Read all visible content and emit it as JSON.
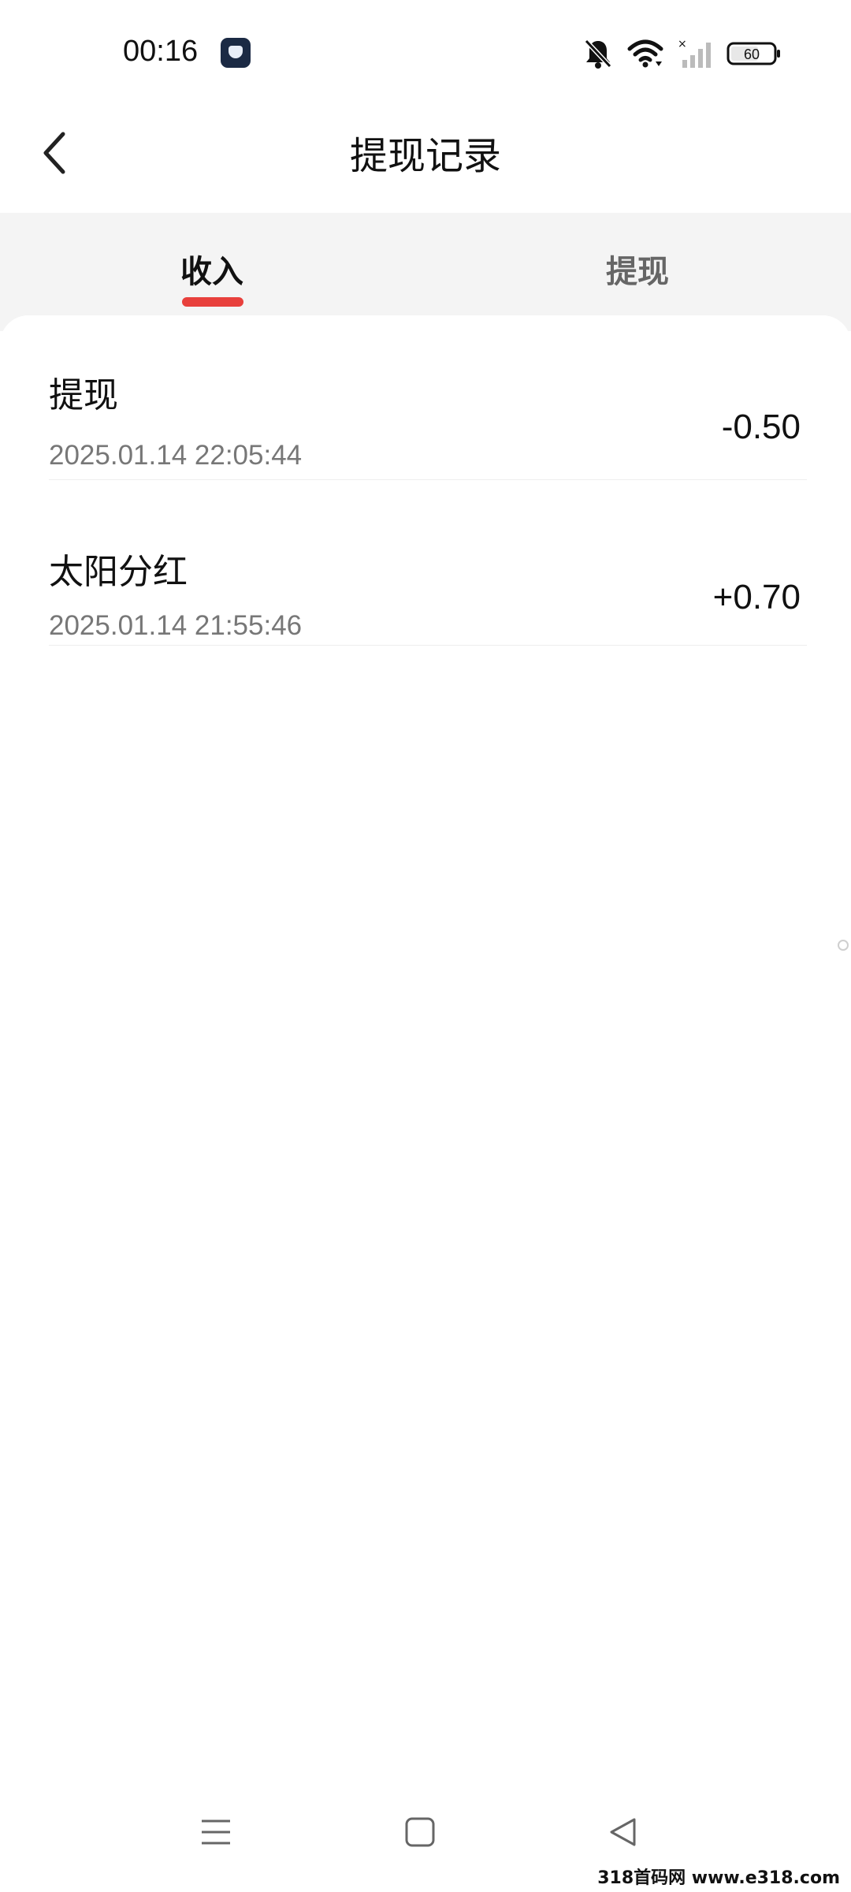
{
  "status_bar": {
    "time": "00:16",
    "battery": "60",
    "icons": [
      "app-badge-icon",
      "bell-off-icon",
      "wifi-icon",
      "signal-icon",
      "battery-icon"
    ]
  },
  "header": {
    "title": "提现记录",
    "back_icon": "chevron-left-icon"
  },
  "tabs": [
    {
      "label": "收入",
      "active": true
    },
    {
      "label": "提现",
      "active": false
    }
  ],
  "accent_color": "#e8403c",
  "records": [
    {
      "title": "提现",
      "time": "2025.01.14 22:05:44",
      "amount": "-0.50"
    },
    {
      "title": "太阳分红",
      "time": "2025.01.14 21:55:46",
      "amount": "+0.70"
    }
  ],
  "nav_bar": {
    "icons": [
      "menu-icon",
      "home-square-icon",
      "back-triangle-icon"
    ]
  },
  "watermark": "318首码网 www.e318.com"
}
